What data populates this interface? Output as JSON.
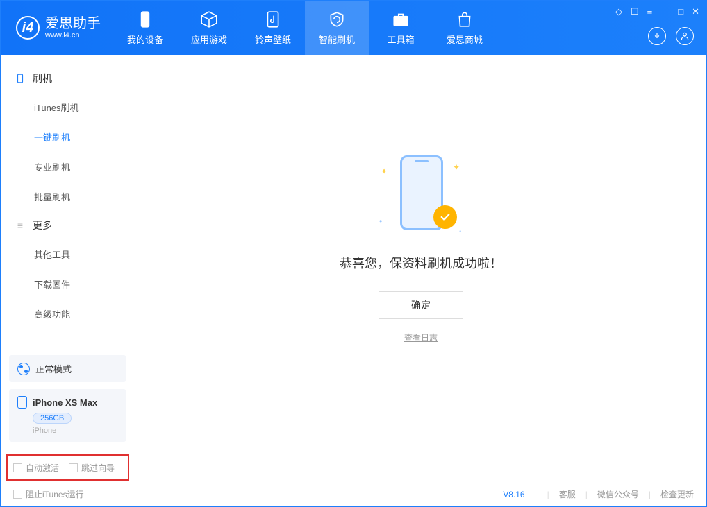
{
  "app": {
    "name": "爱思助手",
    "domain": "www.i4.cn"
  },
  "tabs": {
    "device": "我的设备",
    "apps": "应用游戏",
    "ring": "铃声壁纸",
    "flash": "智能刷机",
    "tools": "工具箱",
    "store": "爱思商城"
  },
  "sidebar": {
    "section_flash": "刷机",
    "itunes": "iTunes刷机",
    "oneclick": "一键刷机",
    "pro": "专业刷机",
    "batch": "批量刷机",
    "section_more": "更多",
    "other": "其他工具",
    "firmware": "下载固件",
    "advanced": "高级功能"
  },
  "device": {
    "mode": "正常模式",
    "name": "iPhone XS Max",
    "storage": "256GB",
    "type": "iPhone"
  },
  "options": {
    "auto_activate": "自动激活",
    "skip_guide": "跳过向导"
  },
  "main": {
    "message": "恭喜您，保资料刷机成功啦！",
    "ok": "确定",
    "log": "查看日志"
  },
  "footer": {
    "block_itunes": "阻止iTunes运行",
    "version": "V8.16",
    "support": "客服",
    "wechat": "微信公众号",
    "update": "检查更新"
  }
}
